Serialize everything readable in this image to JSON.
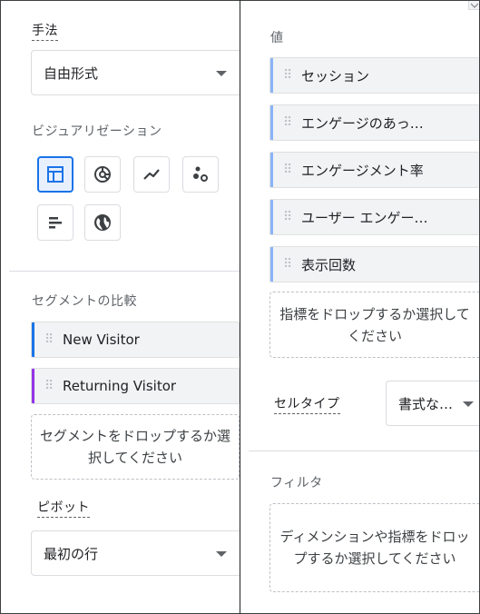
{
  "left": {
    "technique": {
      "label": "手法",
      "selected": "自由形式"
    },
    "visualization": {
      "label": "ビジュアリゼーション",
      "buttons": [
        {
          "icon": "table-icon",
          "selected": true
        },
        {
          "icon": "donut-chart-icon",
          "selected": false
        },
        {
          "icon": "line-chart-icon",
          "selected": false
        },
        {
          "icon": "scatter-chart-icon",
          "selected": false
        },
        {
          "icon": "bar-chart-icon",
          "selected": false
        },
        {
          "icon": "geo-map-icon",
          "selected": false
        }
      ]
    },
    "segments": {
      "label": "セグメントの比較",
      "items": [
        {
          "label": "New Visitor",
          "color": "#1a73e8"
        },
        {
          "label": "Returning Visitor",
          "color": "#9334e6"
        }
      ],
      "drop_text": "セグメントをドロップするか選択してください"
    },
    "pivot": {
      "label": "ピボット",
      "selected": "最初の行"
    }
  },
  "right": {
    "values": {
      "label": "値",
      "items": [
        {
          "label": "セッション",
          "color": "#8ab4f8"
        },
        {
          "label": "エンゲージのあっ…",
          "color": "#8ab4f8"
        },
        {
          "label": "エンゲージメント率",
          "color": "#8ab4f8"
        },
        {
          "label": "ユーザー エンゲー…",
          "color": "#8ab4f8"
        },
        {
          "label": "表示回数",
          "color": "#8ab4f8"
        }
      ],
      "drop_text": "指標をドロップするか選択してください"
    },
    "cell_type": {
      "label": "セルタイプ",
      "selected": "書式な…"
    },
    "filter": {
      "label": "フィルタ",
      "drop_text": "ディメンションや指標をドロップするか選択してください"
    }
  },
  "colors": {
    "accent": "#1a73e8",
    "segment_new": "#1a73e8",
    "segment_returning": "#9334e6",
    "metric_bar": "#8ab4f8"
  }
}
